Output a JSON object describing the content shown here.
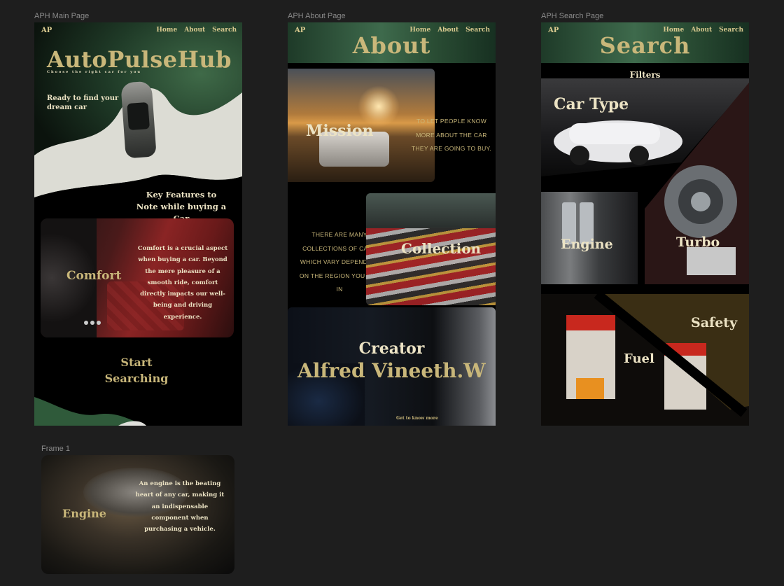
{
  "frames": {
    "main_label": "APH Main Page",
    "about_label": "APH About Page",
    "search_label": "APH Search Page",
    "frame1_label": "Frame 1"
  },
  "nav": {
    "home": "Home",
    "about": "About",
    "search": "Search",
    "logo": "AP"
  },
  "main": {
    "title": "AutoPulseHub",
    "tagline": "Choose the right car for you",
    "ready": "Ready to find your dream car",
    "key_features": "Key Features to Note while buying a Car",
    "comfort_title": "Comfort",
    "comfort_text": "Comfort is a crucial aspect when buying a car. Beyond the mere pleasure of a smooth ride, comfort directly impacts our well-being and driving experience.",
    "start": "Start Searching"
  },
  "about": {
    "title": "About",
    "mission": "Mission",
    "mission_text": "TO LET PEOPLE KNOW MORE ABOUT THE CAR THEY ARE GOING TO BUY.",
    "collection_text": "THERE ARE MANY COLLECTIONS OF CARS WHICH VARY DEPENDING ON THE REGION YOU ARE IN",
    "collection": "Collection",
    "creator": "Creator",
    "creator_name": "Alfred Vineeth.W",
    "get_to_know": "Get to know more"
  },
  "search": {
    "title": "Search",
    "filters": "Filters",
    "car_type": "Car Type",
    "engine": "Engine",
    "turbo": "Turbo",
    "safety": "Safety",
    "fuel": "Fuel"
  },
  "frame1": {
    "engine": "Engine",
    "engine_text": "An engine is the beating heart of any car, making it an indispensable component when purchasing a vehicle."
  },
  "colors": {
    "gold": "#c9b77a",
    "cream": "#ece3c4",
    "canvas": "#1e1e1e",
    "frame_bg": "#000000"
  }
}
